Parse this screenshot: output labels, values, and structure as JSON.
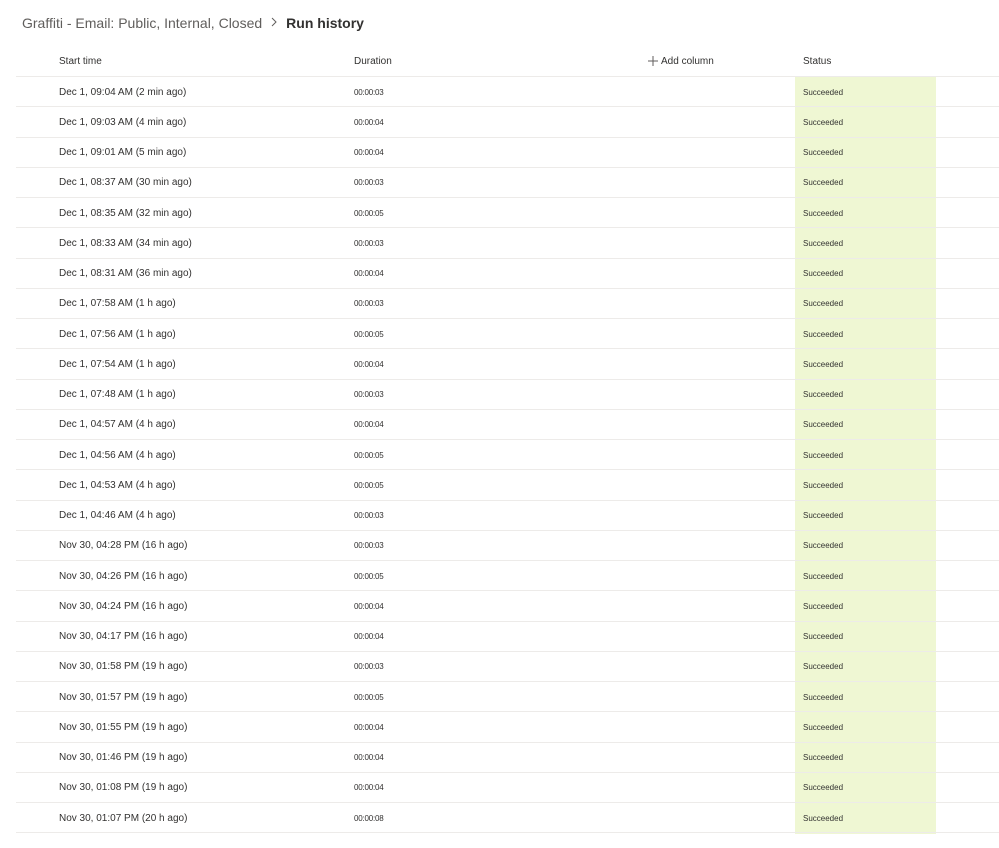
{
  "breadcrumb": {
    "parent": "Graffiti - Email: Public, Internal, Closed",
    "current": "Run history"
  },
  "columns": {
    "start_time": "Start time",
    "duration": "Duration",
    "add_column": "Add column",
    "status": "Status"
  },
  "accent_colors": {
    "status_column_bg": "#eff7d3"
  },
  "rows": [
    {
      "start": "Dec 1, 09:04 AM (2 min ago)",
      "duration": "00:00:03",
      "status": "Succeeded"
    },
    {
      "start": "Dec 1, 09:03 AM (4 min ago)",
      "duration": "00:00:04",
      "status": "Succeeded"
    },
    {
      "start": "Dec 1, 09:01 AM (5 min ago)",
      "duration": "00:00:04",
      "status": "Succeeded"
    },
    {
      "start": "Dec 1, 08:37 AM (30 min ago)",
      "duration": "00:00:03",
      "status": "Succeeded"
    },
    {
      "start": "Dec 1, 08:35 AM (32 min ago)",
      "duration": "00:00:05",
      "status": "Succeeded"
    },
    {
      "start": "Dec 1, 08:33 AM (34 min ago)",
      "duration": "00:00:03",
      "status": "Succeeded"
    },
    {
      "start": "Dec 1, 08:31 AM (36 min ago)",
      "duration": "00:00:04",
      "status": "Succeeded"
    },
    {
      "start": "Dec 1, 07:58 AM (1 h ago)",
      "duration": "00:00:03",
      "status": "Succeeded"
    },
    {
      "start": "Dec 1, 07:56 AM (1 h ago)",
      "duration": "00:00:05",
      "status": "Succeeded"
    },
    {
      "start": "Dec 1, 07:54 AM (1 h ago)",
      "duration": "00:00:04",
      "status": "Succeeded"
    },
    {
      "start": "Dec 1, 07:48 AM (1 h ago)",
      "duration": "00:00:03",
      "status": "Succeeded"
    },
    {
      "start": "Dec 1, 04:57 AM (4 h ago)",
      "duration": "00:00:04",
      "status": "Succeeded"
    },
    {
      "start": "Dec 1, 04:56 AM (4 h ago)",
      "duration": "00:00:05",
      "status": "Succeeded"
    },
    {
      "start": "Dec 1, 04:53 AM (4 h ago)",
      "duration": "00:00:05",
      "status": "Succeeded"
    },
    {
      "start": "Dec 1, 04:46 AM (4 h ago)",
      "duration": "00:00:03",
      "status": "Succeeded"
    },
    {
      "start": "Nov 30, 04:28 PM (16 h ago)",
      "duration": "00:00:03",
      "status": "Succeeded"
    },
    {
      "start": "Nov 30, 04:26 PM (16 h ago)",
      "duration": "00:00:05",
      "status": "Succeeded"
    },
    {
      "start": "Nov 30, 04:24 PM (16 h ago)",
      "duration": "00:00:04",
      "status": "Succeeded"
    },
    {
      "start": "Nov 30, 04:17 PM (16 h ago)",
      "duration": "00:00:04",
      "status": "Succeeded"
    },
    {
      "start": "Nov 30, 01:58 PM (19 h ago)",
      "duration": "00:00:03",
      "status": "Succeeded"
    },
    {
      "start": "Nov 30, 01:57 PM (19 h ago)",
      "duration": "00:00:05",
      "status": "Succeeded"
    },
    {
      "start": "Nov 30, 01:55 PM (19 h ago)",
      "duration": "00:00:04",
      "status": "Succeeded"
    },
    {
      "start": "Nov 30, 01:46 PM (19 h ago)",
      "duration": "00:00:04",
      "status": "Succeeded"
    },
    {
      "start": "Nov 30, 01:08 PM (19 h ago)",
      "duration": "00:00:04",
      "status": "Succeeded"
    },
    {
      "start": "Nov 30, 01:07 PM (20 h ago)",
      "duration": "00:00:08",
      "status": "Succeeded"
    }
  ]
}
